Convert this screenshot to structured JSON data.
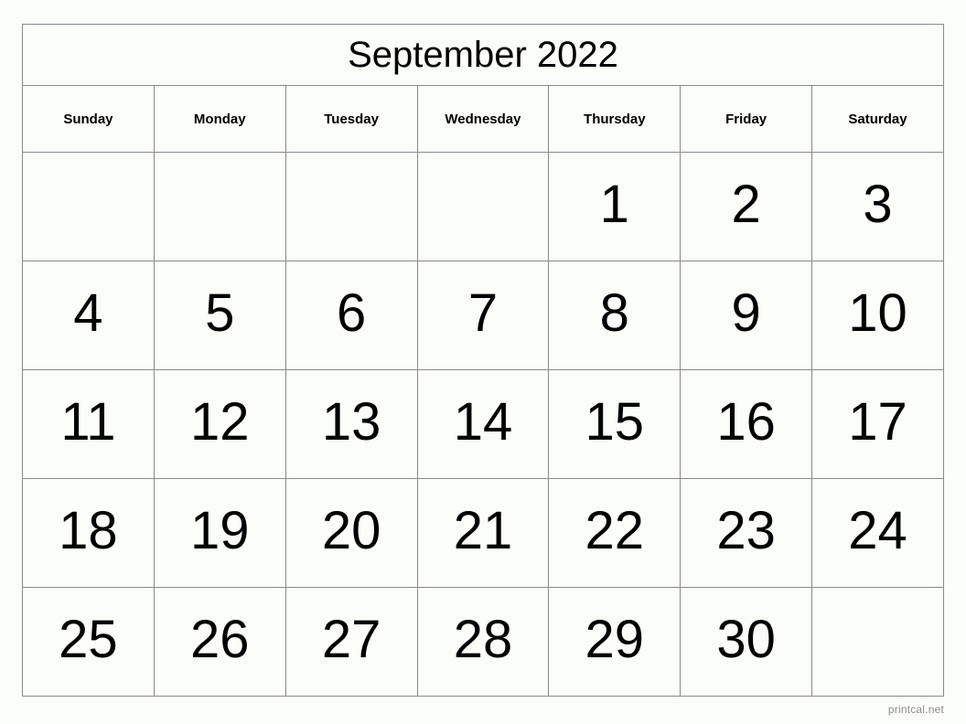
{
  "calendar": {
    "title": "September 2022",
    "weekdays": [
      "Sunday",
      "Monday",
      "Tuesday",
      "Wednesday",
      "Thursday",
      "Friday",
      "Saturday"
    ],
    "weeks": [
      [
        "",
        "",
        "",
        "",
        "1",
        "2",
        "3"
      ],
      [
        "4",
        "5",
        "6",
        "7",
        "8",
        "9",
        "10"
      ],
      [
        "11",
        "12",
        "13",
        "14",
        "15",
        "16",
        "17"
      ],
      [
        "18",
        "19",
        "20",
        "21",
        "22",
        "23",
        "24"
      ],
      [
        "25",
        "26",
        "27",
        "28",
        "29",
        "30",
        ""
      ]
    ],
    "colors": {
      "background": "#fbfdf8",
      "border": "#8a8a8a",
      "text": "#000000",
      "footer_text": "#8d8d8d"
    }
  },
  "footer": {
    "credit": "printcal.net"
  }
}
